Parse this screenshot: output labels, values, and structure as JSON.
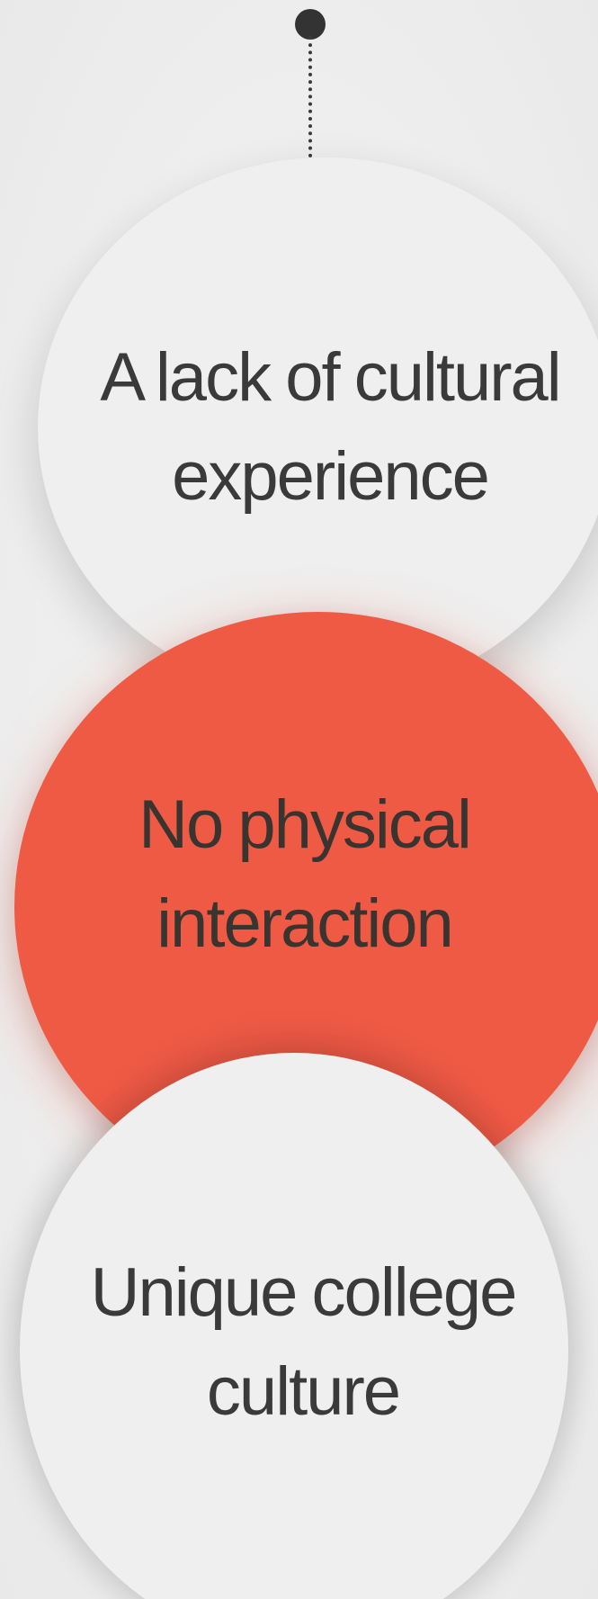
{
  "diagram": {
    "nodes": [
      {
        "id": "top",
        "label_line1": "A lack of cultural",
        "label_line2": "experience",
        "highlighted": false
      },
      {
        "id": "middle",
        "label_line1": "No physical",
        "label_line2": "interaction",
        "highlighted": true
      },
      {
        "id": "bottom",
        "label_line1": "Unique college",
        "label_line2": "culture",
        "highlighted": false
      }
    ]
  },
  "colors": {
    "background": "#eeeeee",
    "circle_neutral": "#efefef",
    "circle_accent": "#ef5a45",
    "text": "#3a3a3a",
    "connector": "#333333"
  },
  "icons": {
    "connector": "dot-with-dotted-line"
  }
}
